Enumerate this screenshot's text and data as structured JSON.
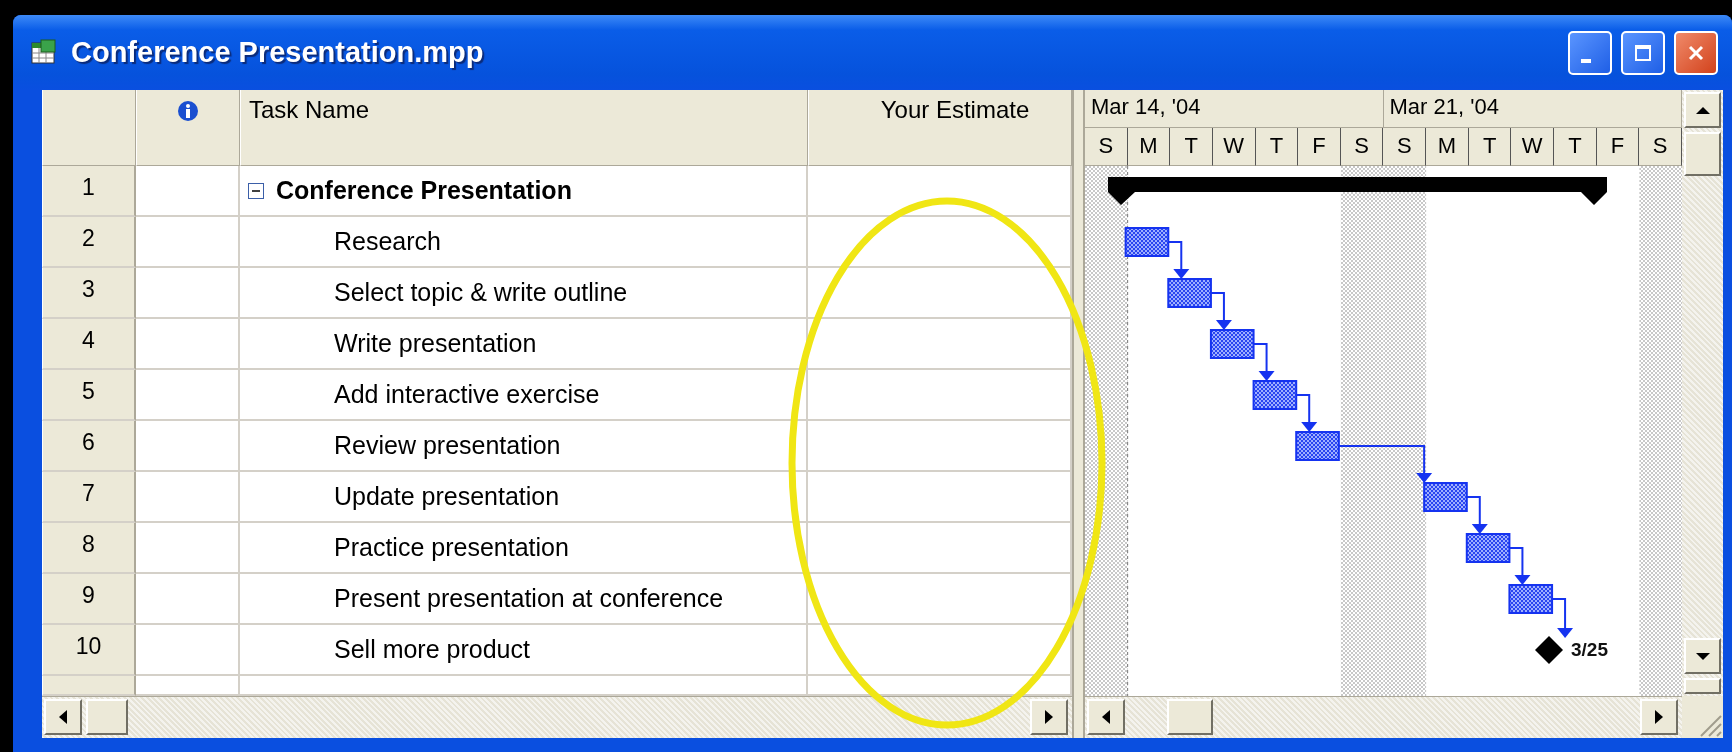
{
  "window": {
    "title": "Conference Presentation.mpp"
  },
  "table": {
    "columns": [
      "Task Name",
      "Your Estimate"
    ],
    "rows": [
      {
        "number": "1",
        "name": "Conference Presentation",
        "kind": "summary",
        "expanded": true
      },
      {
        "number": "2",
        "name": "Research",
        "kind": "task"
      },
      {
        "number": "3",
        "name": "Select topic & write outline",
        "kind": "task"
      },
      {
        "number": "4",
        "name": "Write presentation",
        "kind": "task"
      },
      {
        "number": "5",
        "name": "Add interactive exercise",
        "kind": "task"
      },
      {
        "number": "6",
        "name": "Review presentation",
        "kind": "task"
      },
      {
        "number": "7",
        "name": "Update presentation",
        "kind": "task"
      },
      {
        "number": "8",
        "name": "Practice presentation",
        "kind": "task"
      },
      {
        "number": "9",
        "name": "Present presentation at conference",
        "kind": "task"
      },
      {
        "number": "10",
        "name": "Sell more product",
        "kind": "milestone",
        "gantt_label": "3/25"
      }
    ]
  },
  "timescale": {
    "weeks": [
      "Mar 14, '04",
      "Mar 21, '04"
    ],
    "days": [
      "S",
      "M",
      "T",
      "W",
      "T",
      "F",
      "S",
      "S",
      "M",
      "T",
      "W",
      "T",
      "F",
      "S"
    ]
  }
}
